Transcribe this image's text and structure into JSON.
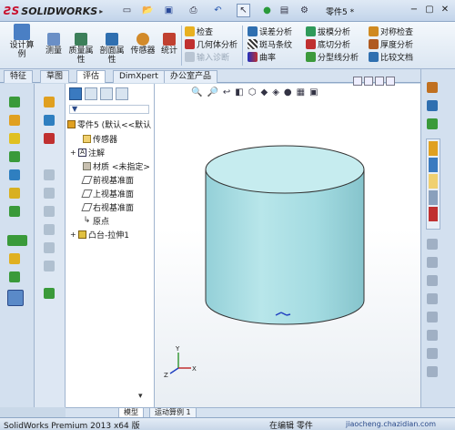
{
  "app": {
    "brand": "SOLIDWORKS",
    "doc_title": "零件5 *",
    "window_controls": [
      "−",
      "▢",
      "✕"
    ]
  },
  "quick_access": [
    "new-doc-icon",
    "open-folder-icon",
    "save-icon",
    "print-icon",
    "undo-icon",
    "select-pointer-icon",
    "traffic-light-icon",
    "properties-icon",
    "options-gear-icon"
  ],
  "ribbon": {
    "big_buttons": [
      {
        "label": "设计算\n例",
        "icon": "design-study-icon",
        "color": "#4a7fc4"
      },
      {
        "label": "测量",
        "icon": "measure-icon",
        "color": "#6a8fc6"
      },
      {
        "label": "质量属\n性",
        "icon": "mass-properties-icon",
        "color": "#3c7f5a"
      },
      {
        "label": "剖面属\n性",
        "icon": "section-properties-icon",
        "color": "#2f6fb0"
      },
      {
        "label": "传感器",
        "icon": "sensor-icon",
        "color": "#d28a2a"
      },
      {
        "label": "统计",
        "icon": "statistics-icon",
        "color": "#c04030"
      }
    ],
    "col1": [
      {
        "label": "检查",
        "icon": "check-icon",
        "color": "#e8b020"
      },
      {
        "label": "几何体分析",
        "icon": "geometry-analysis-icon",
        "color": "#c03030"
      },
      {
        "label": "输入诊断",
        "icon": "import-diagnostics-icon",
        "color": "#9aa8b8",
        "disabled": true
      }
    ],
    "col2": [
      {
        "label": "误差分析",
        "icon": "deviation-analysis-icon",
        "color": "#2f6fb0"
      },
      {
        "label": "斑马条纹",
        "icon": "zebra-stripes-icon",
        "color": "#333333"
      },
      {
        "label": "曲率",
        "icon": "curvature-icon",
        "color": "#4a3cc0"
      }
    ],
    "col3": [
      {
        "label": "拔模分析",
        "icon": "draft-analysis-icon",
        "color": "#2f9a5a"
      },
      {
        "label": "底切分析",
        "icon": "undercut-analysis-icon",
        "color": "#c03030"
      },
      {
        "label": "分型线分析",
        "icon": "parting-line-analysis-icon",
        "color": "#3c9a3c"
      }
    ],
    "col4": [
      {
        "label": "对称检查",
        "icon": "symmetry-check-icon",
        "color": "#d08a20"
      },
      {
        "label": "厚度分析",
        "icon": "thickness-analysis-icon",
        "color": "#b05a20"
      },
      {
        "label": "比较文档",
        "icon": "compare-documents-icon",
        "color": "#2f6fb0"
      }
    ]
  },
  "tabs": [
    {
      "label": "特征",
      "active": false
    },
    {
      "label": "草图",
      "active": false
    },
    {
      "label": "评估",
      "active": true
    },
    {
      "label": "DimXpert",
      "active": false
    },
    {
      "label": "办公室产品",
      "active": false
    }
  ],
  "tree": {
    "root": "零件5  (默认<<默认",
    "items": [
      {
        "label": "传感器",
        "icon": "sensors-folder-icon",
        "expander": ""
      },
      {
        "label": "注解",
        "icon": "annotations-icon",
        "expander": "+"
      },
      {
        "label": "材质 <未指定>",
        "icon": "material-icon",
        "expander": ""
      },
      {
        "label": "前视基准面",
        "icon": "front-plane-icon",
        "expander": ""
      },
      {
        "label": "上视基准面",
        "icon": "top-plane-icon",
        "expander": ""
      },
      {
        "label": "右视基准面",
        "icon": "right-plane-icon",
        "expander": ""
      },
      {
        "label": "原点",
        "icon": "origin-icon",
        "expander": ""
      },
      {
        "label": "凸台-拉伸1",
        "icon": "boss-extrude-icon",
        "expander": "+"
      }
    ]
  },
  "bottom_tabs": [
    "模型",
    "运动算例 1"
  ],
  "status": {
    "left": "SolidWorks Premium 2013 x64 版",
    "middle": "在编辑 零件",
    "right": "jiaocheng.chazidian.com"
  },
  "colors": {
    "cylinder": "#a9dde3",
    "cylinder_top": "#c6ecef",
    "ribbon_bg": "#dbe6f2"
  }
}
